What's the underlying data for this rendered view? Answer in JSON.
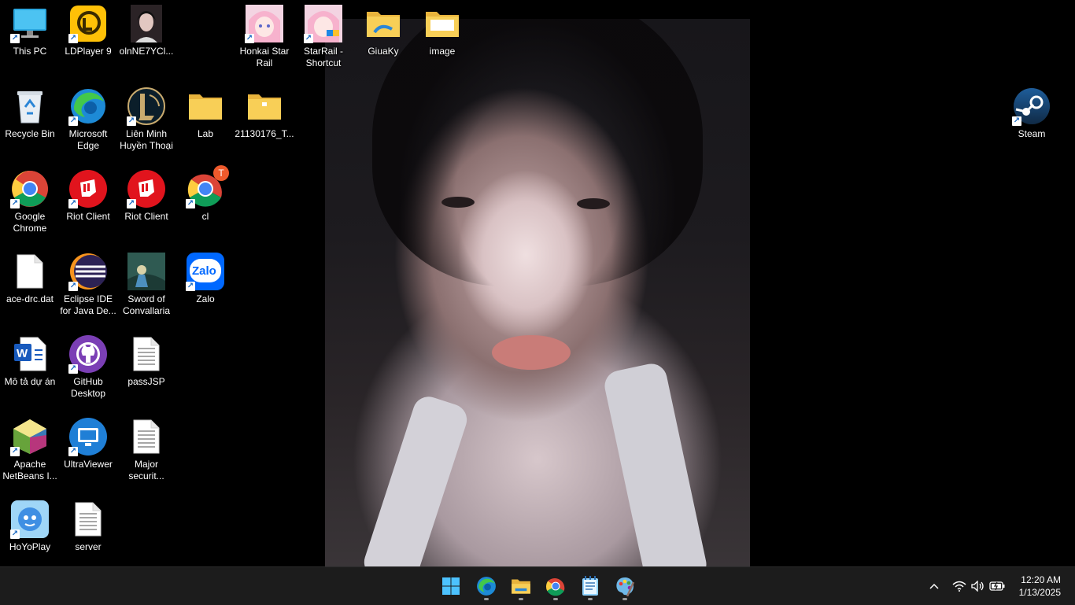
{
  "desktop": {
    "icons": [
      {
        "label": "This PC"
      },
      {
        "label": "LDPlayer 9"
      },
      {
        "label": "olnNE7YCl..."
      },
      {
        "label": "Honkai Star Rail"
      },
      {
        "label": "StarRail - Shortcut"
      },
      {
        "label": "GiuaKy"
      },
      {
        "label": "image"
      },
      {
        "label": "Recycle Bin"
      },
      {
        "label": "Microsoft Edge"
      },
      {
        "label": "Liên Minh Huyền Thoại"
      },
      {
        "label": "Lab"
      },
      {
        "label": "21130176_T..."
      },
      {
        "label": "Steam"
      },
      {
        "label": "Google Chrome"
      },
      {
        "label": "Riot Client"
      },
      {
        "label": "Riot Client"
      },
      {
        "label": "cl"
      },
      {
        "label": "ace-drc.dat"
      },
      {
        "label": "Eclipse IDE for Java De..."
      },
      {
        "label": "Sword of Convallaria"
      },
      {
        "label": "Zalo"
      },
      {
        "label": "Mô tả dự án"
      },
      {
        "label": "GitHub Desktop"
      },
      {
        "label": "passJSP"
      },
      {
        "label": "Apache NetBeans I..."
      },
      {
        "label": "UltraViewer"
      },
      {
        "label": "Major securit..."
      },
      {
        "label": "HoYoPlay"
      },
      {
        "label": "server"
      }
    ],
    "chrome_badge": "T",
    "zalo_text": "Zalo",
    "word_letter": "W"
  },
  "taskbar": {
    "apps": [
      "start-icon",
      "edge-icon",
      "file-explorer-icon",
      "chrome-icon",
      "notepad-icon",
      "paint-icon"
    ],
    "clock": {
      "time": "12:20 AM",
      "date": "1/13/2025"
    }
  },
  "colors": {
    "taskbar": "#1c1c1c",
    "accent": "#0078d4"
  }
}
